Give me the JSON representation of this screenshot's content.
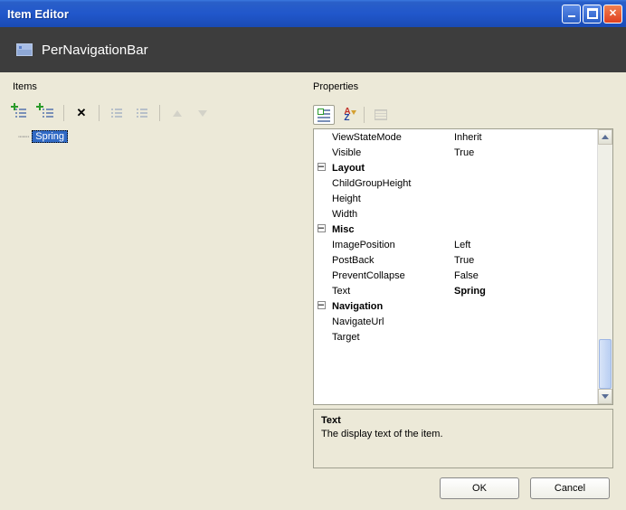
{
  "window": {
    "title": "Item Editor"
  },
  "header": {
    "title": "PerNavigationBar"
  },
  "items_panel": {
    "label": "Items",
    "tree": {
      "selected_node": "Spring"
    }
  },
  "properties_panel": {
    "label": "Properties",
    "rows": [
      {
        "type": "prop",
        "name": "ViewStateMode",
        "value": "Inherit"
      },
      {
        "type": "prop",
        "name": "Visible",
        "value": "True"
      },
      {
        "type": "cat",
        "name": "Layout"
      },
      {
        "type": "prop",
        "name": "ChildGroupHeight",
        "value": ""
      },
      {
        "type": "prop",
        "name": "Height",
        "value": ""
      },
      {
        "type": "prop",
        "name": "Width",
        "value": ""
      },
      {
        "type": "cat",
        "name": "Misc"
      },
      {
        "type": "prop",
        "name": "ImagePosition",
        "value": "Left"
      },
      {
        "type": "prop",
        "name": "PostBack",
        "value": "True"
      },
      {
        "type": "prop",
        "name": "PreventCollapse",
        "value": "False"
      },
      {
        "type": "prop",
        "name": "Text",
        "value": "Spring",
        "bold_value": true
      },
      {
        "type": "cat",
        "name": "Navigation"
      },
      {
        "type": "prop",
        "name": "NavigateUrl",
        "value": ""
      },
      {
        "type": "prop",
        "name": "Target",
        "value": ""
      }
    ],
    "description": {
      "title": "Text",
      "body": "The display text of the item."
    }
  },
  "buttons": {
    "ok": "OK",
    "cancel": "Cancel"
  }
}
